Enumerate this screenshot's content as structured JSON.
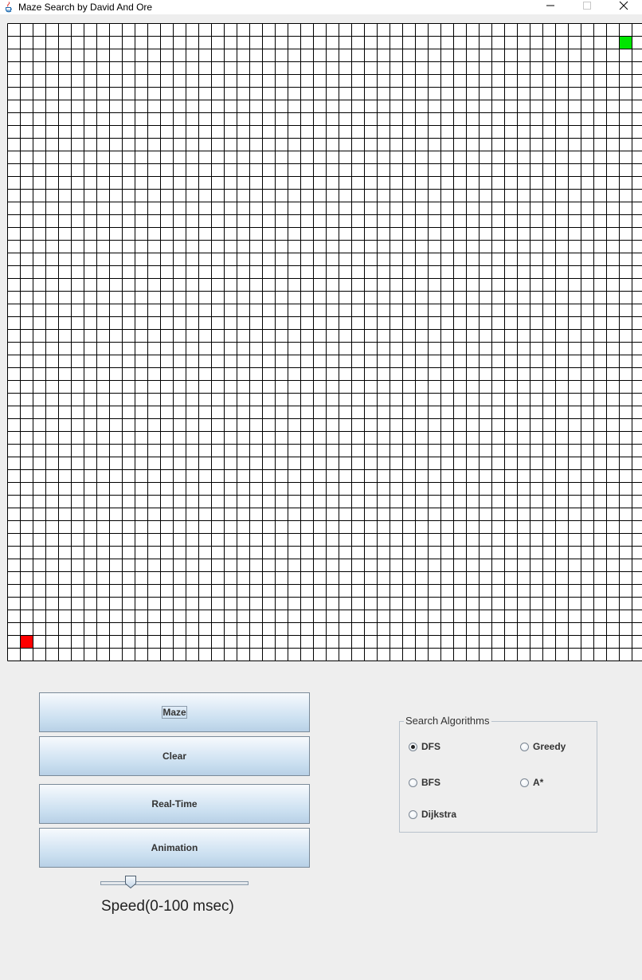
{
  "window": {
    "title": "Maze Search by David And Ore",
    "controls": {
      "minimize": "minimize-icon",
      "maximize": "maximize-icon",
      "close": "close-icon"
    }
  },
  "maze": {
    "rows": 50,
    "cols": 50,
    "grid_color": "#000000",
    "cell_color": "#ffffff",
    "goal": {
      "row": 1,
      "col": 48,
      "color": "#00e600"
    },
    "start": {
      "row": 48,
      "col": 1,
      "color": "#ff0000"
    }
  },
  "controls": {
    "maze_label": "Maze",
    "clear_label": "Clear",
    "realtime_label": "Real-Time",
    "animation_label": "Animation",
    "speed_label": "Speed(0-100 msec)",
    "speed_value": 20
  },
  "algorithms": {
    "title": "Search Algorithms",
    "selected": "DFS",
    "options": [
      {
        "label": "DFS"
      },
      {
        "label": "Greedy"
      },
      {
        "label": "BFS"
      },
      {
        "label": "A*"
      },
      {
        "label": "Dijkstra"
      }
    ]
  }
}
